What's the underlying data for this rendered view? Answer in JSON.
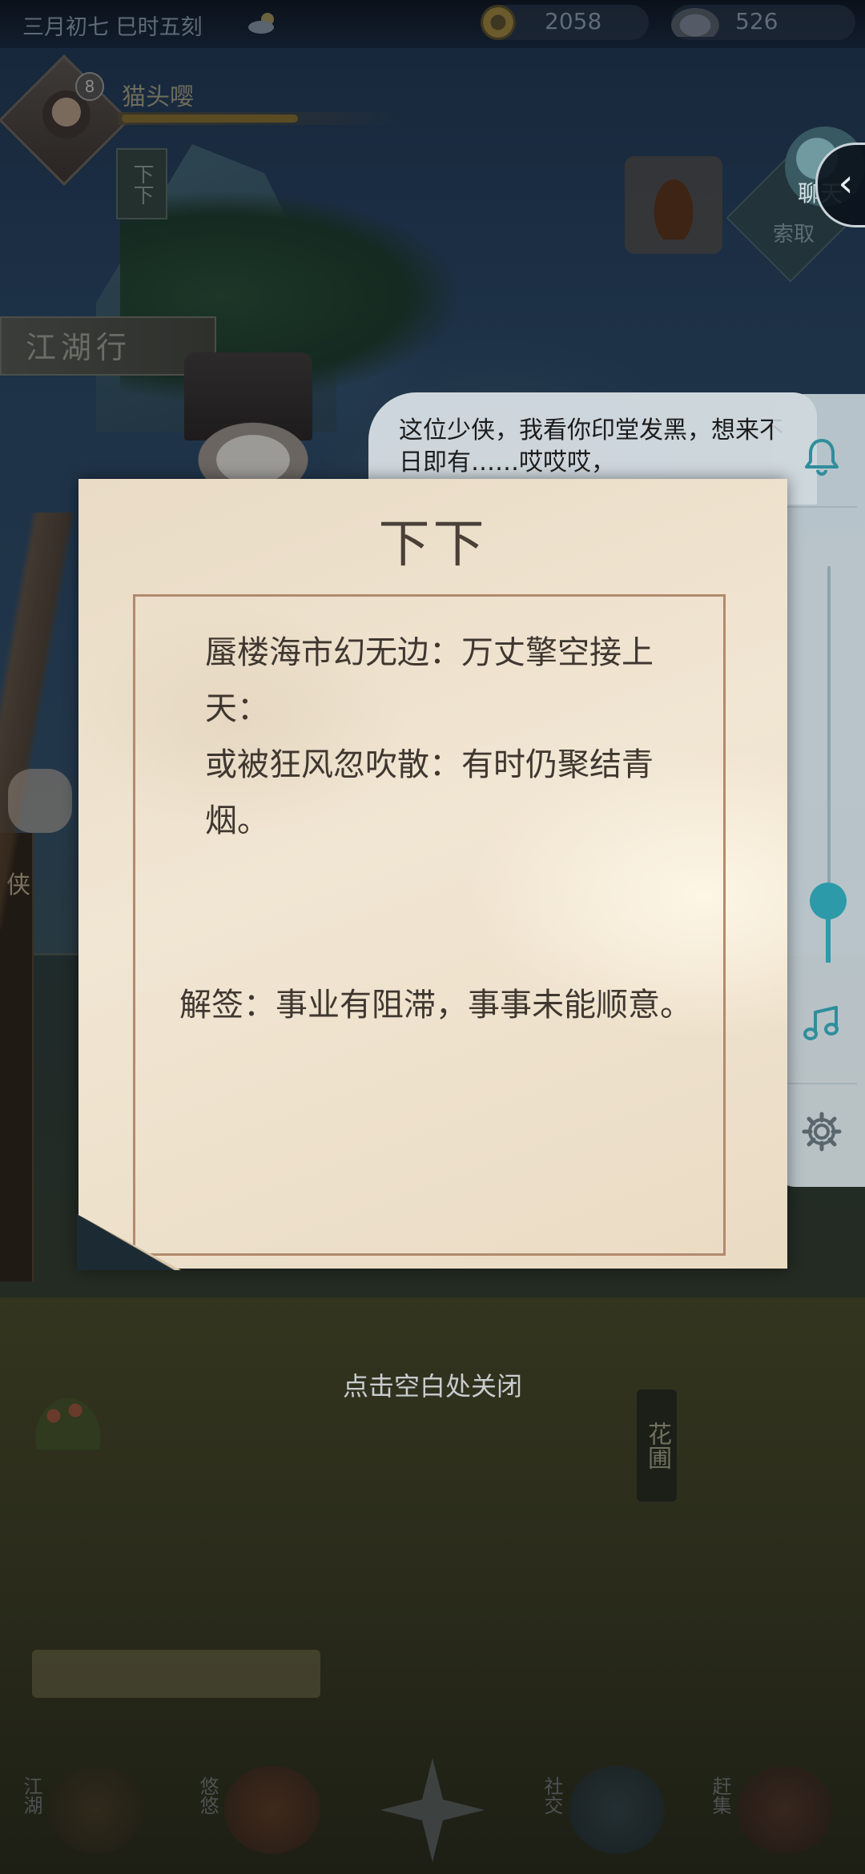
{
  "status": {
    "date": "三月初七  巳时五刻",
    "copper_coins": "2058",
    "silver_ingots": "526"
  },
  "player": {
    "level": "8",
    "name": "猫头嘤"
  },
  "scene": {
    "scroll_tag": "下下",
    "jianghu_sign": "江湖行",
    "solicit_label": "索取",
    "chat_label": "聊天",
    "back_symbol": "‹",
    "dialog": "这位少侠，我看你印堂发黑，想来不日即有……哎哎哎，",
    "side_char": "侠",
    "garden_sign": "花圃"
  },
  "fortune": {
    "title": "下下",
    "poem_lines": [
      "蜃楼海市幻无边：万丈擎空接上天：",
      "或被狂风忽吹散：有时仍聚结青烟。"
    ],
    "interpretation": "解签：事业有阻滞，事事未能顺意。"
  },
  "close_hint": "点击空白处关闭",
  "bottom_nav": [
    {
      "label": "江湖"
    },
    {
      "label": "悠悠"
    },
    {
      "label": "社交"
    },
    {
      "label": "赶集"
    }
  ]
}
